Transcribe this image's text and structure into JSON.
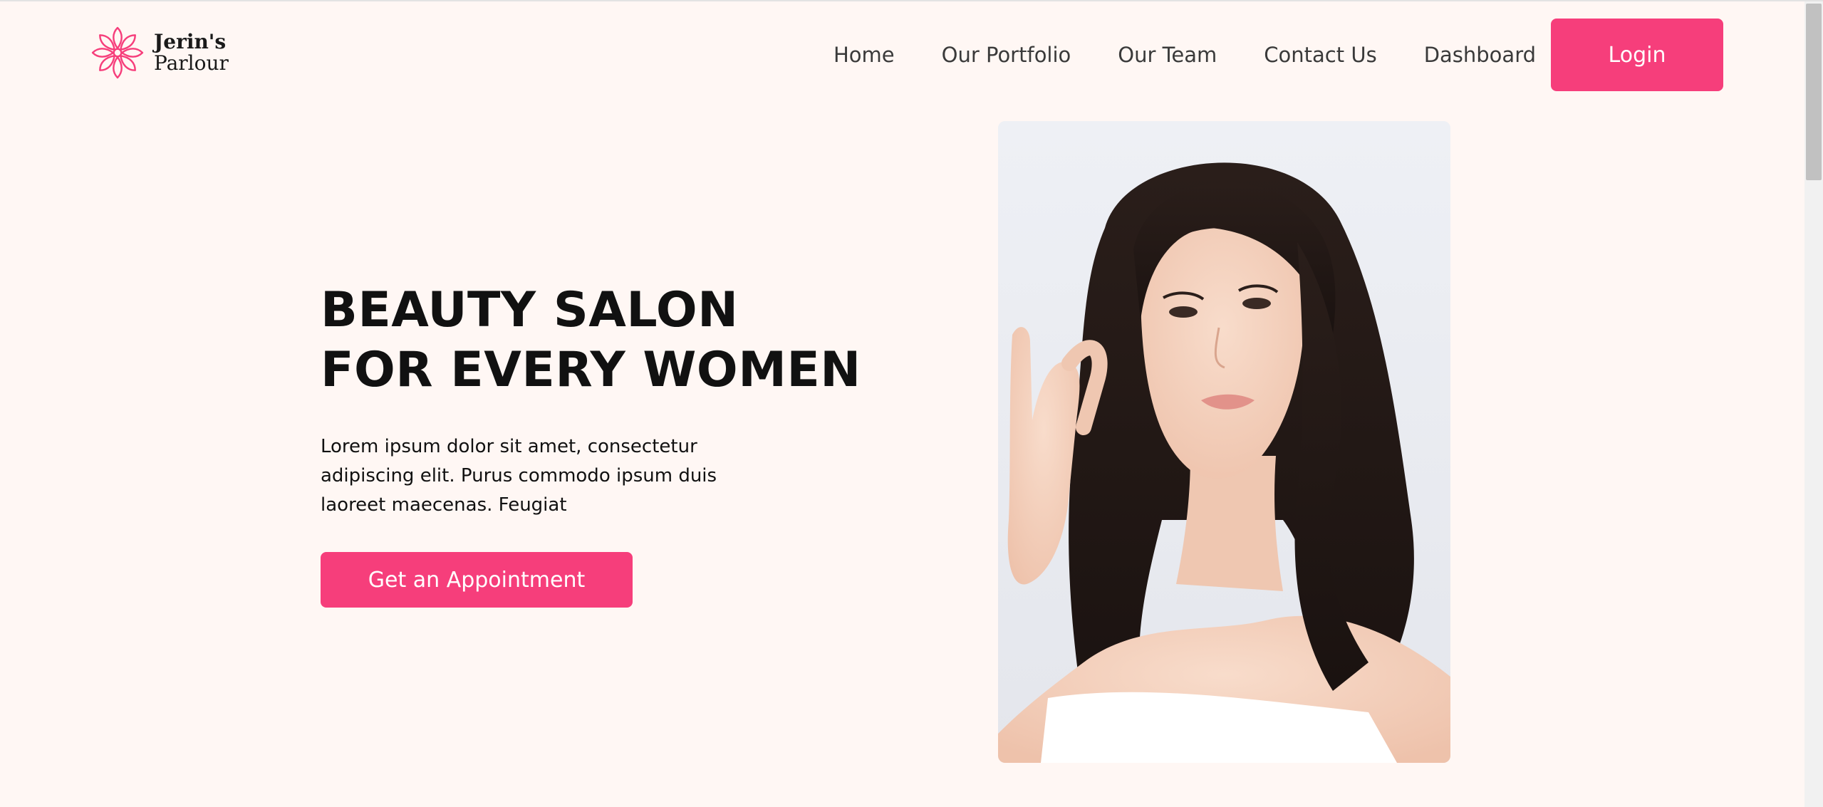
{
  "brand": {
    "name_line1": "Jerin's",
    "name_line2": "Parlour",
    "accent_color": "#F63E7B",
    "logo_icon": "lotus-flower-icon"
  },
  "nav": {
    "items": [
      {
        "label": "Home"
      },
      {
        "label": "Our Portfolio"
      },
      {
        "label": "Our Team"
      },
      {
        "label": "Contact Us"
      },
      {
        "label": "Dashboard"
      }
    ],
    "login_label": "Login"
  },
  "hero": {
    "headline_line1": "BEAUTY SALON",
    "headline_line2": "FOR EVERY WOMEN",
    "body": "Lorem ipsum dolor sit amet, consectetur adipiscing elit. Purus commodo ipsum duis laoreet maecenas. Feugiat",
    "cta_label": "Get an Appointment",
    "image_icon": "woman-portrait-photo"
  },
  "colors": {
    "background": "#FFF7F4",
    "text": "#111111",
    "nav_text": "#3a3a3a"
  }
}
